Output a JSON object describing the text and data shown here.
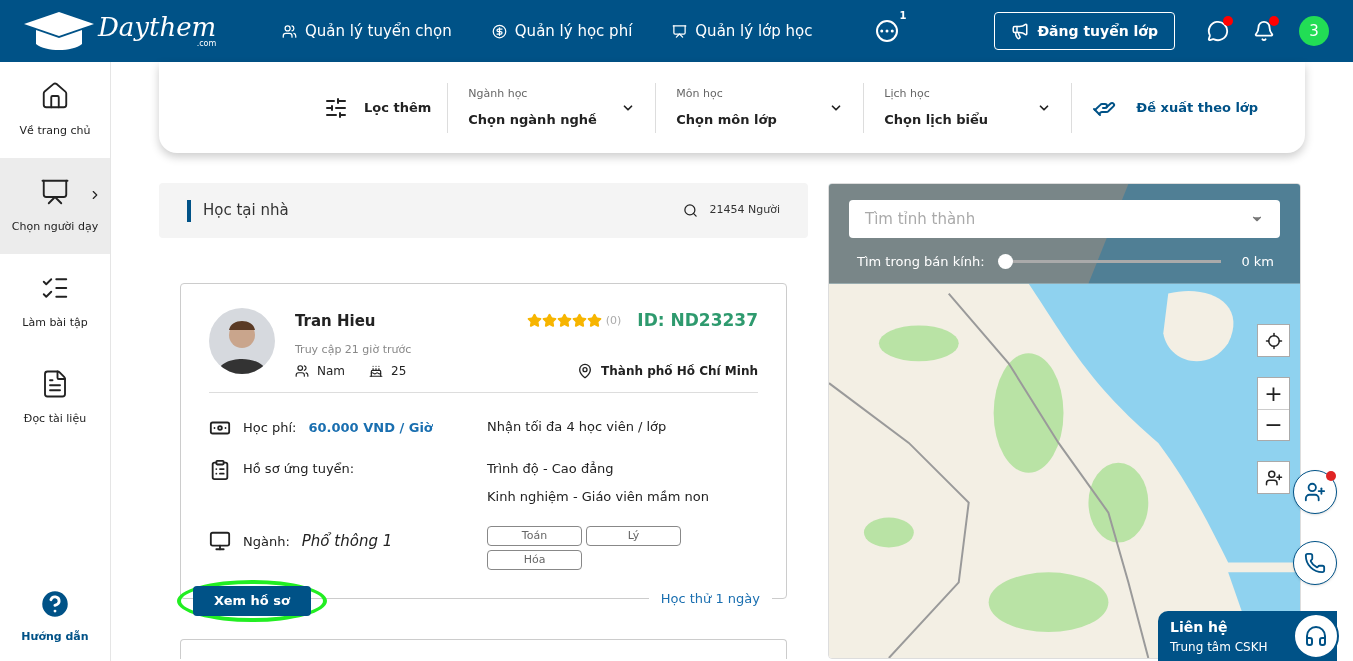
{
  "header": {
    "logo": "Daythem",
    "logo_sub": ".com",
    "nav": [
      {
        "label": "Quản lý tuyển chọn",
        "kind": "people"
      },
      {
        "label": "Quản lý học phí",
        "kind": "money"
      },
      {
        "label": "Quản lý lớp học",
        "kind": "board"
      }
    ],
    "more_badge": "1",
    "post_button": "Đăng tuyển lớp",
    "chat_unread": true,
    "bell_unread": true,
    "avatar": "3"
  },
  "sidebar": {
    "items": [
      {
        "label": "Về trang chủ",
        "kind": "home",
        "selected": false
      },
      {
        "label": "Chọn người dạy",
        "kind": "teacher",
        "selected": true
      },
      {
        "label": "Làm bài tập",
        "kind": "quiz",
        "selected": false
      },
      {
        "label": "Đọc tài liệu",
        "kind": "pdf",
        "selected": false
      }
    ],
    "help": "Hướng dẫn"
  },
  "filters": {
    "more": "Lọc thêm",
    "selects": [
      {
        "label": "Ngành học",
        "value": "Chọn ngành nghề"
      },
      {
        "label": "Môn học",
        "value": "Chọn môn lớp"
      },
      {
        "label": "Lịch học",
        "value": "Chọn lịch biểu"
      }
    ],
    "suggest": "Đề xuất theo lớp"
  },
  "list_header": {
    "title": "Học tại nhà",
    "count": "21454 Người"
  },
  "card": {
    "name": "Tran Hieu",
    "last_seen": "Truy cập 21 giờ trước",
    "gender": "Nam",
    "age": "25",
    "stars": 5,
    "reviews": "(0)",
    "id": "ID: ND23237",
    "location": "Thành phố Hồ Chí Minh",
    "fee_label": "Học phí:",
    "fee": "60.000 VND / Giờ",
    "capacity": "Nhận tối đa 4 học viên / lớp",
    "profile_label": "Hồ sơ ứng tuyển:",
    "profile_lines": [
      "Trình độ - Cao đẳng",
      "Kinh nghiệm - Giáo viên mầm non"
    ],
    "field_label": "Ngành:",
    "field": "Phổ thông 1",
    "subjects": [
      "Toán",
      "Lý",
      "Hóa"
    ],
    "button": "Xem hồ sơ",
    "highlighted": true,
    "trial": "Học thử 1 ngày"
  },
  "map": {
    "province_placeholder": "Tìm tỉnh thành",
    "radius_label": "Tìm trong bán kính:",
    "radius": {
      "level": 0
    },
    "radius_value": "0 km",
    "zoom_in": "+",
    "zoom_out": "−"
  },
  "contact": {
    "title": "Liên hệ",
    "subtitle": "Trung tâm CSKH",
    "invite_unread": true
  }
}
